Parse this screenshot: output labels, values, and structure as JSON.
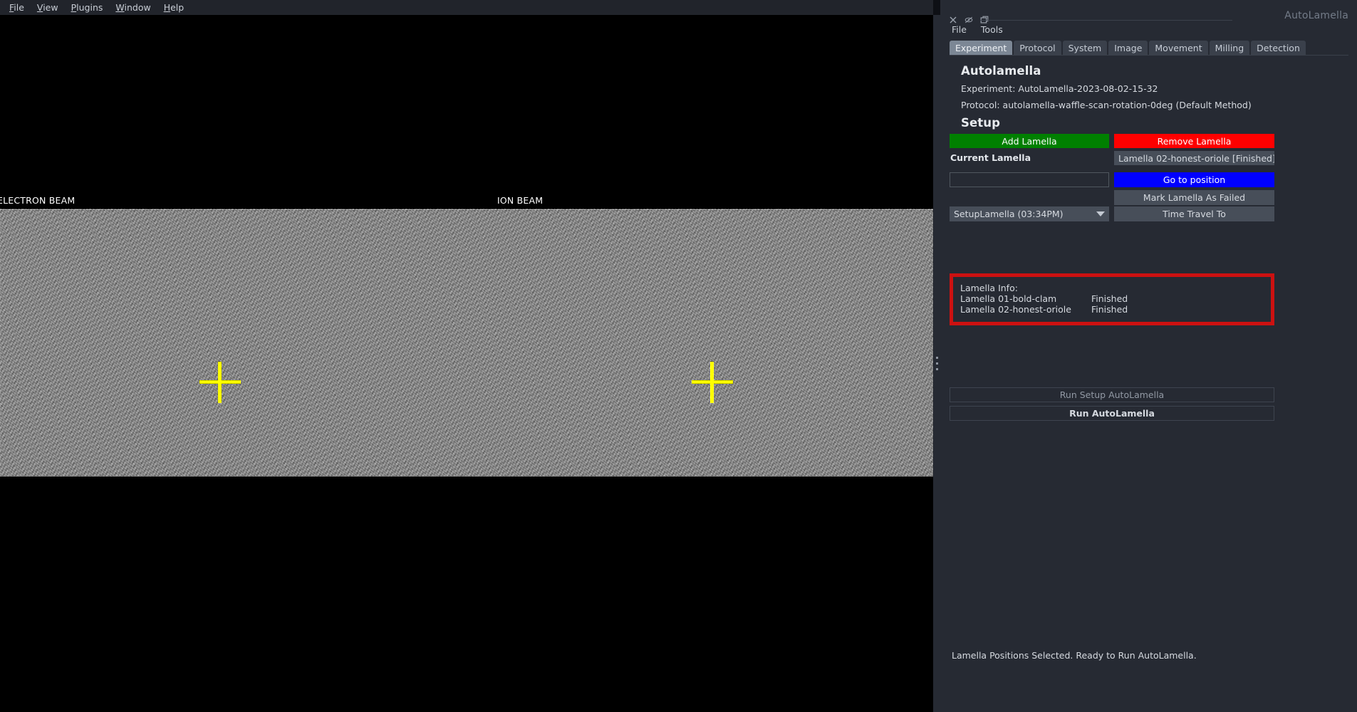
{
  "viewer": {
    "menubar": [
      {
        "label": "File",
        "mnemonic": "F"
      },
      {
        "label": "View",
        "mnemonic": "V"
      },
      {
        "label": "Plugins",
        "mnemonic": "P"
      },
      {
        "label": "Window",
        "mnemonic": "W"
      },
      {
        "label": "Help",
        "mnemonic": "H"
      }
    ],
    "electron_beam_label": "ELECTRON BEAM",
    "ion_beam_label": "ION BEAM",
    "crosshair_color": "#ffff00"
  },
  "dock": {
    "title": "AutoLamella",
    "icons": [
      "close-icon",
      "hide-icon",
      "float-icon"
    ],
    "menubar": [
      "File",
      "Tools"
    ],
    "tabs": [
      {
        "label": "Experiment",
        "active": true
      },
      {
        "label": "Protocol",
        "active": false
      },
      {
        "label": "System",
        "active": false
      },
      {
        "label": "Image",
        "active": false
      },
      {
        "label": "Movement",
        "active": false
      },
      {
        "label": "Milling",
        "active": false
      },
      {
        "label": "Detection",
        "active": false
      }
    ],
    "experiment": {
      "heading": "Autolamella",
      "experiment_line": "Experiment: AutoLamella-2023-08-02-15-32",
      "protocol_line": "Protocol: autolamella-waffle-scan-rotation-0deg (Default Method)",
      "setup_heading": "Setup",
      "add_lamella_label": "Add Lamella",
      "remove_lamella_label": "Remove Lamella",
      "current_lamella_label": "Current Lamella",
      "current_lamella_value": "Lamella 02-honest-oriole [Finished]",
      "lamella_name_value": "",
      "lamella_name_placeholder": "",
      "go_to_position_label": "Go to position",
      "mark_failed_label": "Mark Lamella As Failed",
      "stage_history_value": "SetupLamella (03:34PM)",
      "time_travel_label": "Time Travel To",
      "info": {
        "title": "Lamella Info:",
        "rows": [
          {
            "name": "Lamella 01-bold-clam",
            "status": "Finished"
          },
          {
            "name": "Lamella 02-honest-oriole",
            "status": "Finished"
          }
        ]
      },
      "run_setup_label": "Run Setup AutoLamella",
      "run_auto_label": "Run AutoLamella"
    },
    "statusbar": "Lamella Positions Selected. Ready to Run AutoLamella."
  },
  "colors": {
    "add": "#008000",
    "remove": "#ff0000",
    "goto": "#0000ff",
    "highlight_border": "#cc1111",
    "panel_bg": "#262a33",
    "crosshair": "#ffff00"
  }
}
